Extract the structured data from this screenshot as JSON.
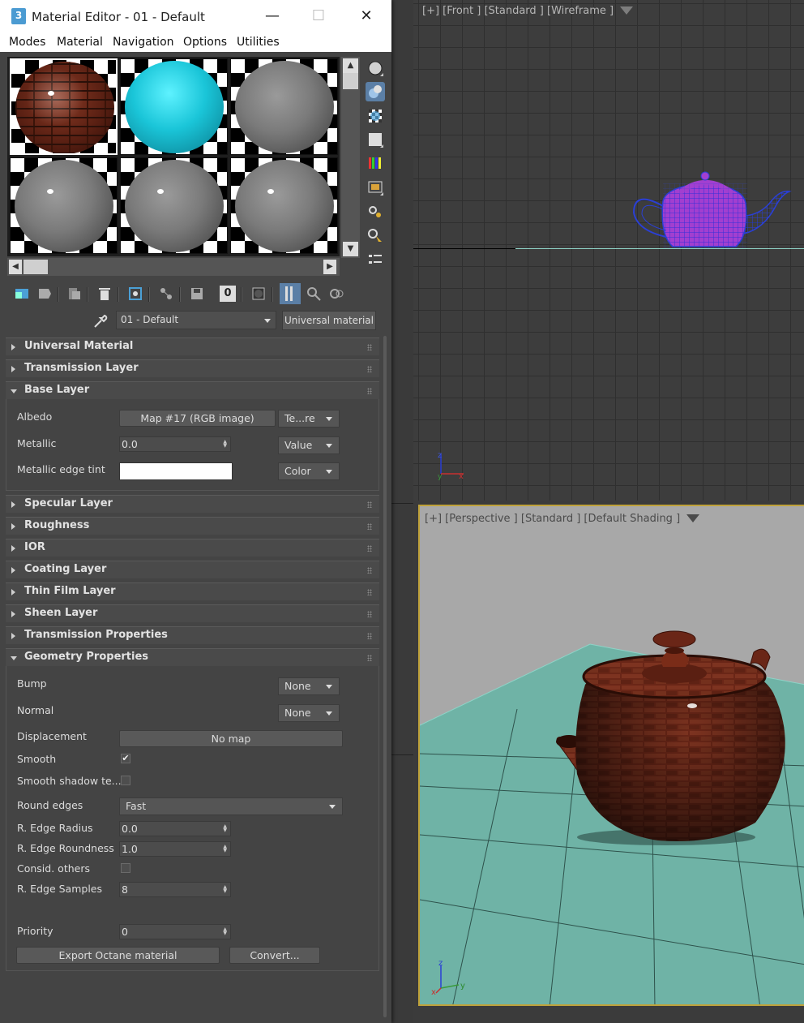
{
  "window": {
    "title": "Material Editor - 01 - Default",
    "app_icon": "3",
    "minimize": "—",
    "maximize": "☐",
    "close": "✕"
  },
  "menu": [
    "Modes",
    "Material",
    "Navigation",
    "Options",
    "Utilities"
  ],
  "material_slots": [
    {
      "type": "brick"
    },
    {
      "type": "cyan"
    },
    {
      "type": "grey"
    },
    {
      "type": "grey"
    },
    {
      "type": "grey"
    },
    {
      "type": "grey"
    }
  ],
  "material_name": "01 - Default",
  "material_type": "Universal material",
  "rollouts": {
    "universal": "Universal Material",
    "transmission_layer": "Transmission Layer",
    "base_layer": "Base Layer",
    "specular": "Specular Layer",
    "roughness": "Roughness",
    "ior": "IOR",
    "coating": "Coating Layer",
    "thin_film": "Thin Film Layer",
    "sheen": "Sheen Layer",
    "transmission_props": "Transmission Properties",
    "geometry_props": "Geometry Properties"
  },
  "base_layer": {
    "albedo_label": "Albedo",
    "albedo_map": "Map #17 (RGB image)",
    "albedo_mode": "Te...re",
    "metallic_label": "Metallic",
    "metallic_value": "0.0",
    "metallic_mode": "Value",
    "metallic_edge_label": "Metallic edge tint",
    "metallic_edge_mode": "Color"
  },
  "geometry": {
    "bump_label": "Bump",
    "bump_value": "None",
    "normal_label": "Normal",
    "normal_value": "None",
    "displacement_label": "Displacement",
    "displacement_value": "No map",
    "smooth_label": "Smooth",
    "smooth_checked": "✔",
    "smooth_shadow_label": "Smooth shadow te...",
    "round_edges_label": "Round edges",
    "round_edges_value": "Fast",
    "edge_radius_label": "R. Edge Radius",
    "edge_radius_value": "0.0",
    "edge_roundness_label": "R. Edge Roundness",
    "edge_roundness_value": "1.0",
    "consid_label": "Consid. others",
    "edge_samples_label": "R. Edge Samples",
    "edge_samples_value": "8",
    "priority_label": "Priority",
    "priority_value": "0",
    "export_button": "Export Octane material",
    "convert_button": "Convert..."
  },
  "viewports": {
    "front": "[+] [Front ] [Standard ] [Wireframe ]",
    "perspective": "[+] [Perspective ] [Standard ] [Default Shading ]"
  },
  "gizmo": {
    "x": "x",
    "y": "y",
    "z": "z"
  },
  "toolbar_zero": "0",
  "colors": {
    "accent": "#bfa23a",
    "cyan": "#1ac5d8",
    "floor": "#6fb3a6",
    "wire": "#2a3fd6"
  }
}
